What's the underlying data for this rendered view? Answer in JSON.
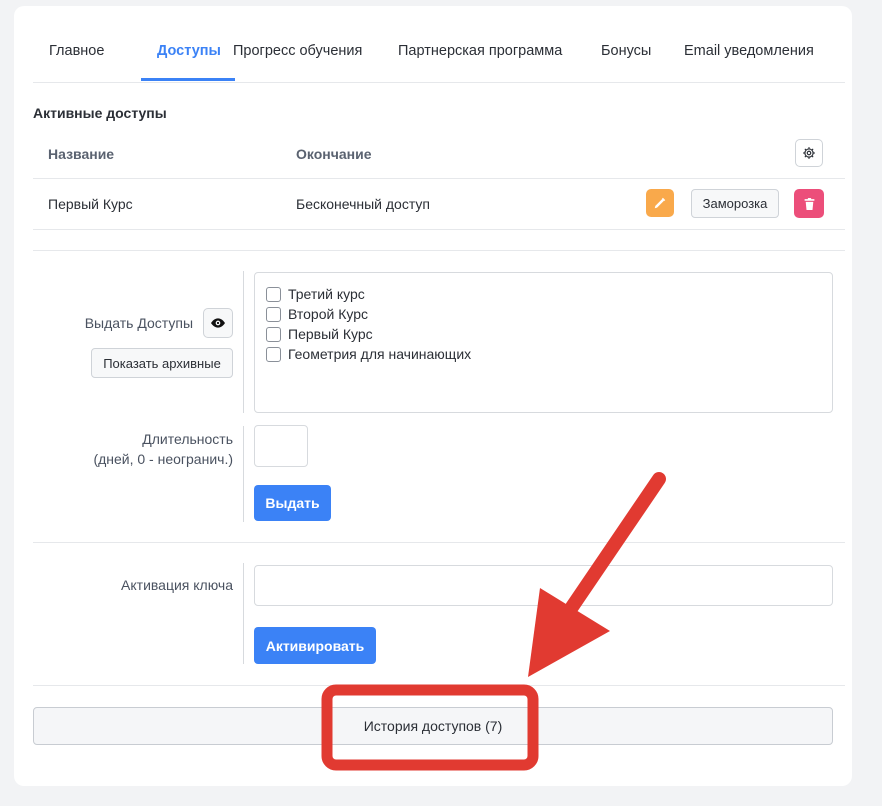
{
  "tabs": [
    {
      "label": "Главное"
    },
    {
      "label": "Доступы"
    },
    {
      "label": "Прогресс обучения"
    },
    {
      "label": "Партнерская программа"
    },
    {
      "label": "Бонусы"
    },
    {
      "label": "Email уведомления"
    }
  ],
  "active_tab": "Доступы",
  "access": {
    "title": "Активные доступы",
    "columns": [
      "Название",
      "Окончание"
    ],
    "rows": [
      {
        "name": "Первый Курс",
        "end": "Бесконечный доступ",
        "freeze_label": "Заморозка"
      }
    ]
  },
  "grant": {
    "label": "Выдать Доступы",
    "show_archived_label": "Показать архивные",
    "courses": [
      "Третий курс",
      "Второй Курс",
      "Первый Курс",
      "Геометрия для начинающих"
    ],
    "duration_label_1": "Длительность",
    "duration_label_2": "(дней, 0 - неогранич.)",
    "duration_value": "",
    "submit_label": "Выдать"
  },
  "activation": {
    "label": "Активация ключа",
    "value": "",
    "submit_label": "Активировать"
  },
  "history": {
    "label": "История доступов (7)"
  },
  "colors": {
    "accent": "#3b82f6",
    "edit": "#f9a94b",
    "delete": "#ec4e7a",
    "annotation": "#e13a31"
  }
}
